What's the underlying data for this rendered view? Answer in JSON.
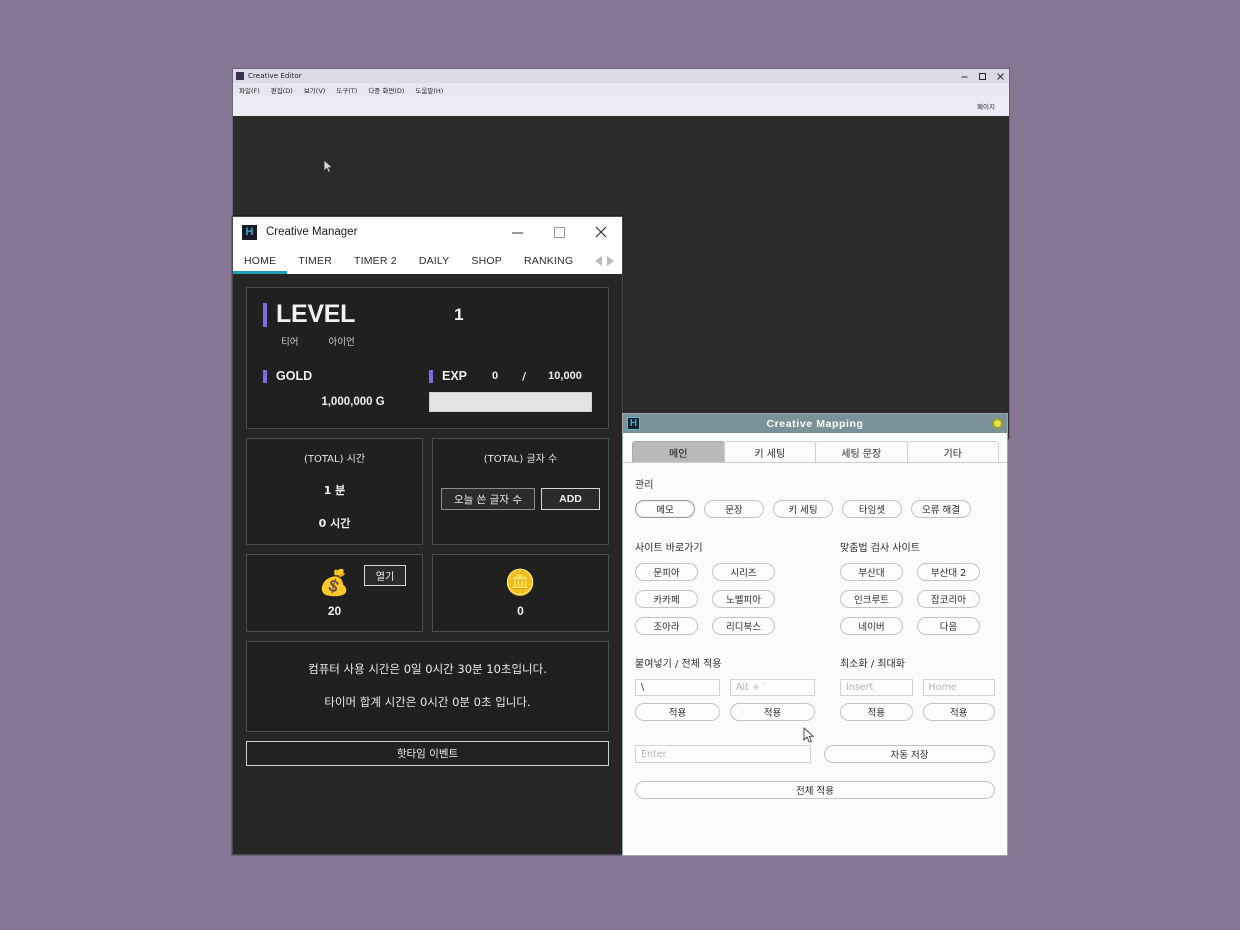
{
  "desktop": {
    "background": "#857693"
  },
  "editor_window": {
    "title": "Creative Editor",
    "icon": "app-icon",
    "menus": [
      "파일(F)",
      "편집(D)",
      "보기(V)",
      "도구(T)",
      "다중 화면(D)",
      "도움말(H)"
    ],
    "subbar_label": "페이지",
    "window_buttons": {
      "minimize": "─",
      "maximize": "❐",
      "close": "✕"
    }
  },
  "manager_window": {
    "title": "Creative Manager",
    "icon_letter": "H",
    "window_buttons": {
      "minimize": "minimize-icon",
      "maximize": "maximize-icon",
      "close": "close-icon"
    },
    "tabs": [
      {
        "label": "HOME",
        "active": true
      },
      {
        "label": "TIMER",
        "active": false
      },
      {
        "label": "TIMER 2",
        "active": false
      },
      {
        "label": "DAILY",
        "active": false
      },
      {
        "label": "SHOP",
        "active": false
      },
      {
        "label": "RANKING",
        "active": false
      }
    ],
    "tab_nav": {
      "prev": "arrow-left-icon",
      "next": "arrow-right-icon"
    },
    "accent_color": "#7a6ee0",
    "tab_underline_color": "#1ba1b5",
    "level_panel": {
      "level_label": "LEVEL",
      "level_value": "1",
      "tier_label": "티어",
      "tier_value": "아이언",
      "gold_label": "GOLD",
      "gold_amount": "1,000,000 G",
      "exp_label": "EXP",
      "exp_current": "0",
      "exp_separator": "/",
      "exp_max": "10,000",
      "exp_progress_percent": 0
    },
    "total_time": {
      "title": "(TOTAL) 시간",
      "minutes": "1 분",
      "hours": "0 시간"
    },
    "total_chars": {
      "title": "(TOTAL) 글자 수",
      "input_value": "오늘 쓴 글자 수",
      "add_label": "ADD"
    },
    "money_box": {
      "icon": "money-bag-icon",
      "emoji": "💰",
      "count": "20",
      "open_label": "열기"
    },
    "gold_box": {
      "icon": "gold-bars-icon",
      "emoji": "🪙",
      "count": "0"
    },
    "messages": [
      "컴퓨터 사용 시간은 0일 0시간 30분 10초입니다.",
      "타이머 합계 시간은 0시간 0분 0초 입니다."
    ],
    "hottime_button": "핫타임 이벤트"
  },
  "mapping_window": {
    "title": "Creative Mapping",
    "icon_letter": "H",
    "close_icon": "close-dot-icon",
    "titlebar_color": "#7b9199",
    "tabs": [
      {
        "label": "메인",
        "active": true
      },
      {
        "label": "키 세팅",
        "active": false
      },
      {
        "label": "세팅 문장",
        "active": false
      },
      {
        "label": "기타",
        "active": false
      }
    ],
    "manage": {
      "label": "관리",
      "buttons": [
        "메모",
        "문장",
        "키 세팅",
        "타임셋",
        "오류 해결"
      ]
    },
    "site_shortcuts": {
      "label": "사이트 바로가기",
      "buttons": [
        "문피아",
        "시리즈",
        "카카페",
        "노벨피아",
        "조아라",
        "리디북스"
      ]
    },
    "spellcheck_sites": {
      "label": "맞춤법 검사 사이트",
      "buttons": [
        "부산대",
        "부산대 2",
        "인크루트",
        "잡코리아",
        "네이버",
        "다음"
      ]
    },
    "hotkeys_left": {
      "label": "붙여넣기  /  전체 적용",
      "inputs": [
        {
          "value": "\\",
          "placeholder": "",
          "is_placeholder": false
        },
        {
          "value": "Alt + `",
          "placeholder": "Alt + `",
          "is_placeholder": true
        }
      ],
      "apply_labels": [
        "적용",
        "적용"
      ]
    },
    "hotkeys_right": {
      "label": "최소화  /  최대화",
      "inputs": [
        {
          "value": "Insert",
          "placeholder": "Insert",
          "is_placeholder": true
        },
        {
          "value": "Home",
          "placeholder": "Home",
          "is_placeholder": true
        }
      ],
      "apply_labels": [
        "적용",
        "적용"
      ]
    },
    "enter_input_placeholder": "Enter",
    "autosave_label": "자동 저장",
    "applyall_label": "전체 적용"
  }
}
